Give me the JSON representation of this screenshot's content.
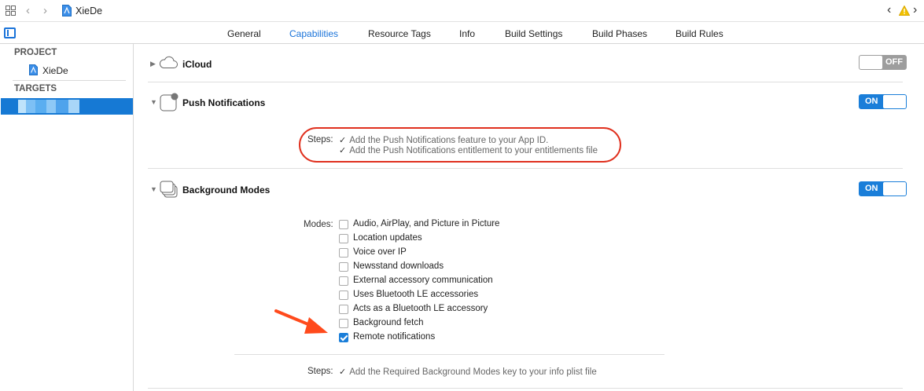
{
  "jumpbar": {
    "project_name": "XieDe"
  },
  "tabs": [
    {
      "label": "General",
      "active": false
    },
    {
      "label": "Capabilities",
      "active": true
    },
    {
      "label": "Resource Tags",
      "active": false
    },
    {
      "label": "Info",
      "active": false
    },
    {
      "label": "Build Settings",
      "active": false
    },
    {
      "label": "Build Phases",
      "active": false
    },
    {
      "label": "Build Rules",
      "active": false
    }
  ],
  "sidebar": {
    "project_header": "PROJECT",
    "project_item": "XieDe",
    "targets_header": "TARGETS"
  },
  "capabilities": {
    "icloud": {
      "title": "iCloud",
      "toggle": "OFF"
    },
    "push": {
      "title": "Push Notifications",
      "toggle": "ON",
      "steps_label": "Steps:",
      "steps": [
        "Add the Push Notifications feature to your App ID.",
        "Add the Push Notifications entitlement to your entitlements file"
      ]
    },
    "background": {
      "title": "Background Modes",
      "toggle": "ON",
      "modes_label": "Modes:",
      "modes": [
        {
          "label": "Audio, AirPlay, and Picture in Picture",
          "checked": false
        },
        {
          "label": "Location updates",
          "checked": false
        },
        {
          "label": "Voice over IP",
          "checked": false
        },
        {
          "label": "Newsstand downloads",
          "checked": false
        },
        {
          "label": "External accessory communication",
          "checked": false
        },
        {
          "label": "Uses Bluetooth LE accessories",
          "checked": false
        },
        {
          "label": "Acts as a Bluetooth LE accessory",
          "checked": false
        },
        {
          "label": "Background fetch",
          "checked": false
        },
        {
          "label": "Remote notifications",
          "checked": true
        }
      ],
      "steps_label": "Steps:",
      "steps": [
        "Add the Required Background Modes key to your info plist file"
      ]
    }
  },
  "colors": {
    "accent": "#1a7ed9",
    "annotation": "#e0301e"
  }
}
